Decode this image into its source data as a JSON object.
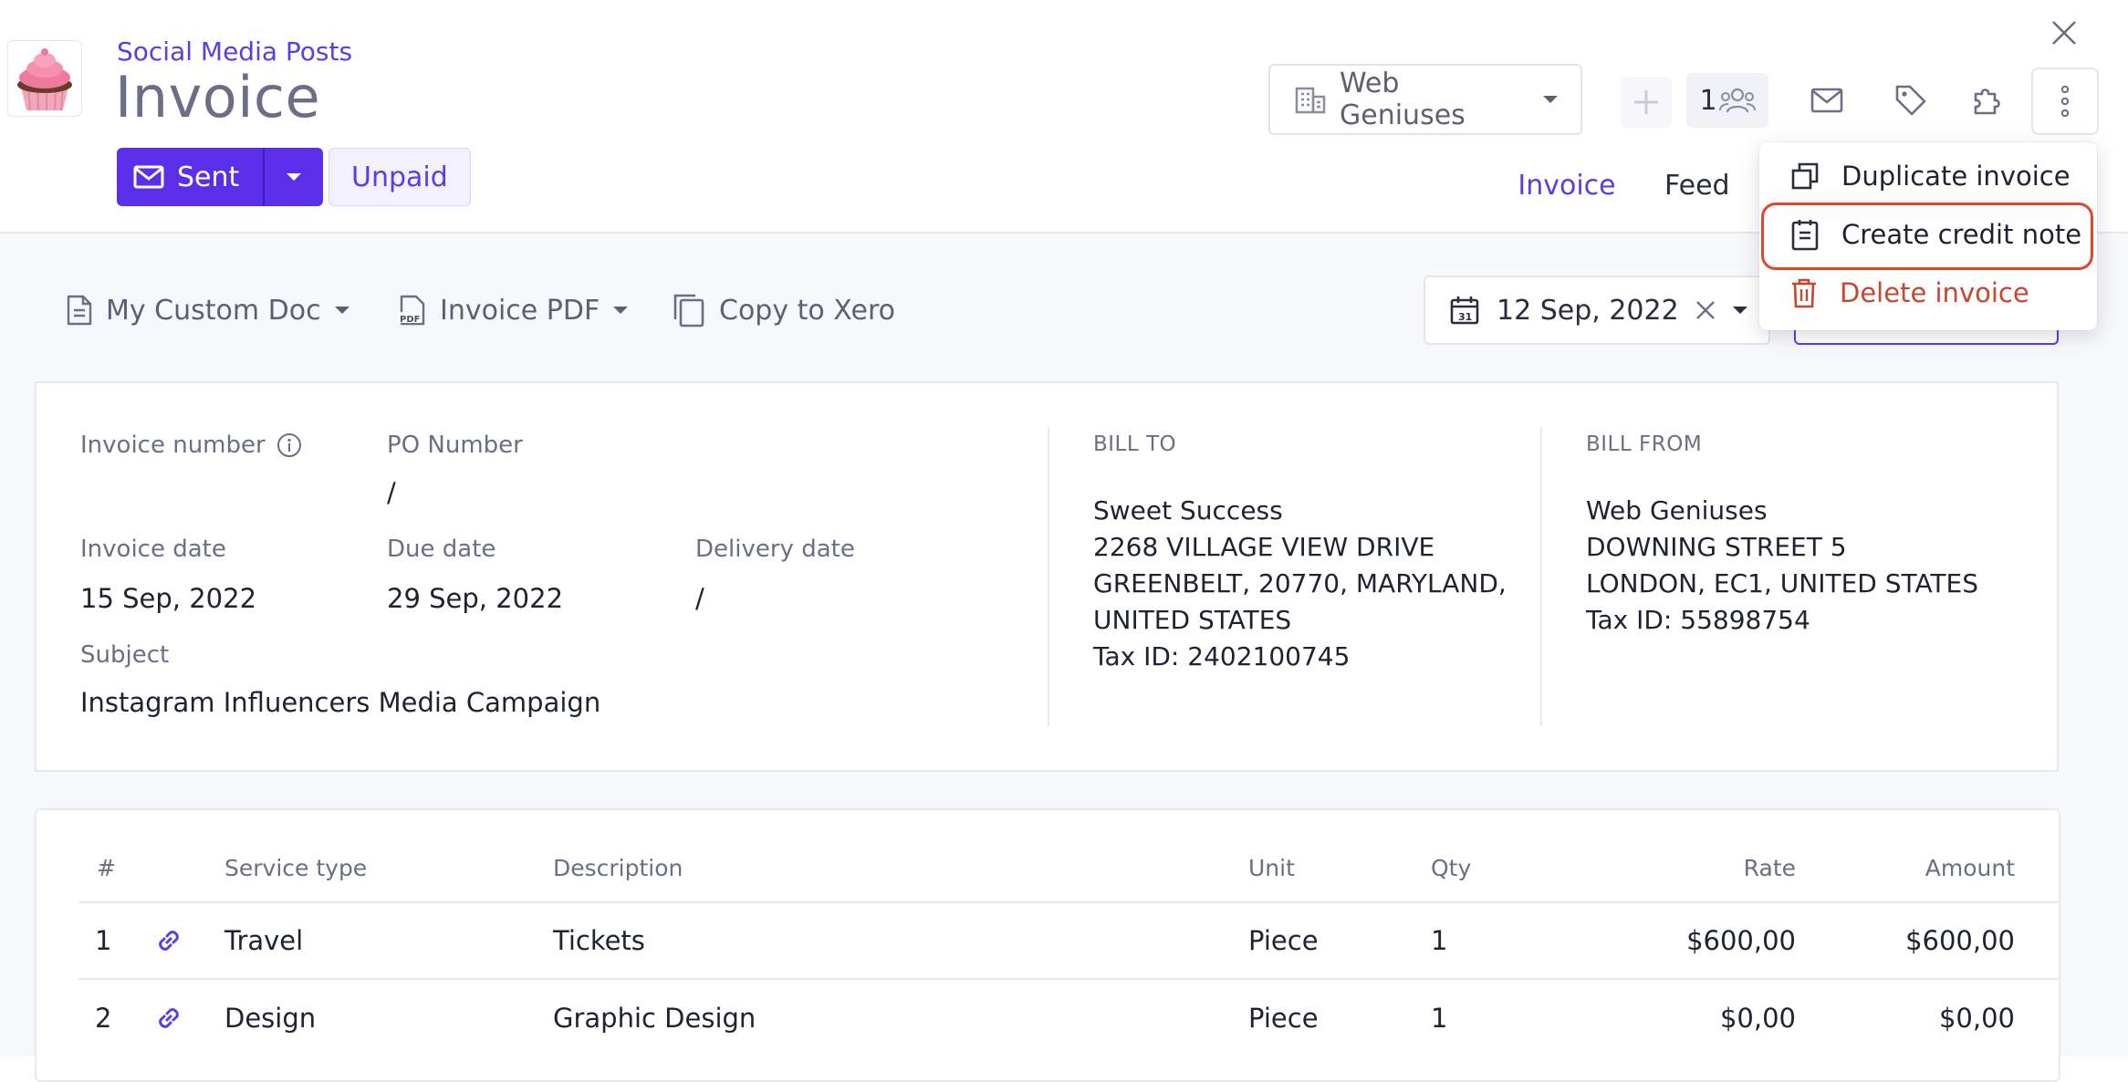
{
  "header": {
    "breadcrumb": "Social Media Posts",
    "title": "Invoice",
    "sent_label": "Sent",
    "unpaid_label": "Unpaid",
    "company": "Web Geniuses",
    "members_count": "1"
  },
  "tabs": [
    {
      "label": "Invoice",
      "active": true
    },
    {
      "label": "Feed",
      "active": false
    }
  ],
  "menu": {
    "items": [
      {
        "label": "Duplicate invoice"
      },
      {
        "label": "Create credit note",
        "highlighted": true
      },
      {
        "label": "Delete invoice",
        "danger": true
      }
    ]
  },
  "toolbar": {
    "doc_template": "My Custom Doc",
    "pdf": "Invoice PDF",
    "xero": "Copy to Xero",
    "date": "12 Sep, 2022"
  },
  "details": {
    "invoice_number_label": "Invoice number",
    "po_number_label": "PO Number",
    "po_number_value": "/",
    "invoice_date_label": "Invoice date",
    "invoice_date_value": "15 Sep, 2022",
    "due_date_label": "Due date",
    "due_date_value": "29 Sep, 2022",
    "delivery_date_label": "Delivery date",
    "delivery_date_value": "/",
    "subject_label": "Subject",
    "subject_value": "Instagram Influencers Media Campaign"
  },
  "bill_to": {
    "label": "BILL TO",
    "name": "Sweet Success",
    "line1": "2268 VILLAGE VIEW DRIVE",
    "line2": "GREENBELT, 20770, MARYLAND,",
    "line3": "UNITED STATES",
    "tax": "Tax ID: 2402100745"
  },
  "bill_from": {
    "label": "BILL FROM",
    "name": "Web Geniuses",
    "line1": "DOWNING STREET 5",
    "line2": "LONDON, EC1, UNITED STATES",
    "tax": "Tax ID: 55898754"
  },
  "table": {
    "headers": {
      "num": "#",
      "service": "Service type",
      "description": "Description",
      "unit": "Unit",
      "qty": "Qty",
      "rate": "Rate",
      "amount": "Amount"
    },
    "rows": [
      {
        "num": "1",
        "service": "Travel",
        "description": "Tickets",
        "unit": "Piece",
        "qty": "1",
        "rate": "$600,00",
        "amount": "$600,00"
      },
      {
        "num": "2",
        "service": "Design",
        "description": "Graphic Design",
        "unit": "Piece",
        "qty": "1",
        "rate": "$0,00",
        "amount": "$0,00"
      }
    ]
  },
  "colors": {
    "accent": "#5b2eea",
    "danger": "#c8452f",
    "highlight": "#e0472a"
  }
}
